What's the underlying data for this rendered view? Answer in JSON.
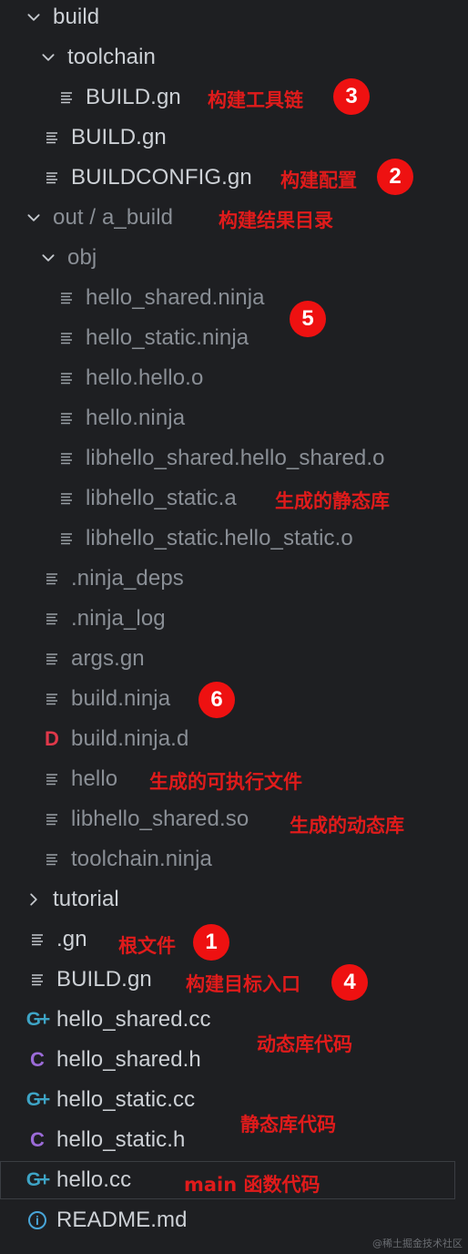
{
  "explorer": {
    "rows": [
      {
        "label": "build",
        "kind": "folder-open",
        "dim": false
      },
      {
        "label": "toolchain",
        "kind": "folder-open",
        "dim": false
      },
      {
        "label": "BUILD.gn",
        "kind": "file-lines",
        "dim": false
      },
      {
        "label": "BUILD.gn",
        "kind": "file-lines",
        "dim": false
      },
      {
        "label": "BUILDCONFIG.gn",
        "kind": "file-lines",
        "dim": false
      },
      {
        "label": "out / a_build",
        "kind": "folder-open",
        "dim": true
      },
      {
        "label": "obj",
        "kind": "folder-open",
        "dim": true
      },
      {
        "label": "hello_shared.ninja",
        "kind": "file-lines",
        "dim": true
      },
      {
        "label": "hello_static.ninja",
        "kind": "file-lines",
        "dim": true
      },
      {
        "label": "hello.hello.o",
        "kind": "file-lines",
        "dim": true
      },
      {
        "label": "hello.ninja",
        "kind": "file-lines",
        "dim": true
      },
      {
        "label": "libhello_shared.hello_shared.o",
        "kind": "file-lines",
        "dim": true
      },
      {
        "label": "libhello_static.a",
        "kind": "file-lines",
        "dim": true
      },
      {
        "label": "libhello_static.hello_static.o",
        "kind": "file-lines",
        "dim": true
      },
      {
        "label": ".ninja_deps",
        "kind": "file-lines",
        "dim": true
      },
      {
        "label": ".ninja_log",
        "kind": "file-lines",
        "dim": true
      },
      {
        "label": "args.gn",
        "kind": "file-lines",
        "dim": true
      },
      {
        "label": "build.ninja",
        "kind": "file-lines",
        "dim": true
      },
      {
        "label": "build.ninja.d",
        "kind": "file-d",
        "dim": true
      },
      {
        "label": "hello",
        "kind": "file-lines",
        "dim": true
      },
      {
        "label": "libhello_shared.so",
        "kind": "file-lines",
        "dim": true
      },
      {
        "label": "toolchain.ninja",
        "kind": "file-lines",
        "dim": true
      },
      {
        "label": "tutorial",
        "kind": "folder-closed",
        "dim": false
      },
      {
        "label": ".gn",
        "kind": "file-lines",
        "dim": false
      },
      {
        "label": "BUILD.gn",
        "kind": "file-lines",
        "dim": false
      },
      {
        "label": "hello_shared.cc",
        "kind": "file-cpp",
        "dim": false
      },
      {
        "label": "hello_shared.h",
        "kind": "file-c",
        "dim": false
      },
      {
        "label": "hello_static.cc",
        "kind": "file-cpp",
        "dim": false
      },
      {
        "label": "hello_static.h",
        "kind": "file-c",
        "dim": false
      },
      {
        "label": "hello.cc",
        "kind": "file-cpp",
        "dim": false,
        "selected": true
      },
      {
        "label": "README.md",
        "kind": "file-info",
        "dim": false
      }
    ],
    "icon_glyphs": {
      "file-d": "D",
      "file-c": "C",
      "file-cpp": "G+",
      "file-info": "i"
    }
  },
  "annotations": {
    "toolchain_note": "构建工具链",
    "buildconfig_note": "构建配置",
    "out_note": "构建结果目录",
    "static_lib_note": "生成的静态库",
    "executable_note": "生成的可执行文件",
    "shared_lib_note": "生成的动态库",
    "gn_note": "根文件",
    "build_gn_note": "构建目标入口",
    "shared_code_note": "动态库代码",
    "static_code_note": "静态库代码",
    "main_code_note": "main 函数代码"
  },
  "badges": {
    "one": "1",
    "two": "2",
    "three": "3",
    "four": "4",
    "five": "5",
    "six": "6"
  },
  "watermark": "@稀土掘金技术社区",
  "colors": {
    "background": "#1e1f22",
    "annotation_red": "#e01b1b",
    "badge_red": "#ee1111",
    "c_icon": "#9b6bd8",
    "cpp_icon": "#3ea4c6",
    "d_icon": "#e0384a",
    "info_icon": "#48a5d8"
  }
}
